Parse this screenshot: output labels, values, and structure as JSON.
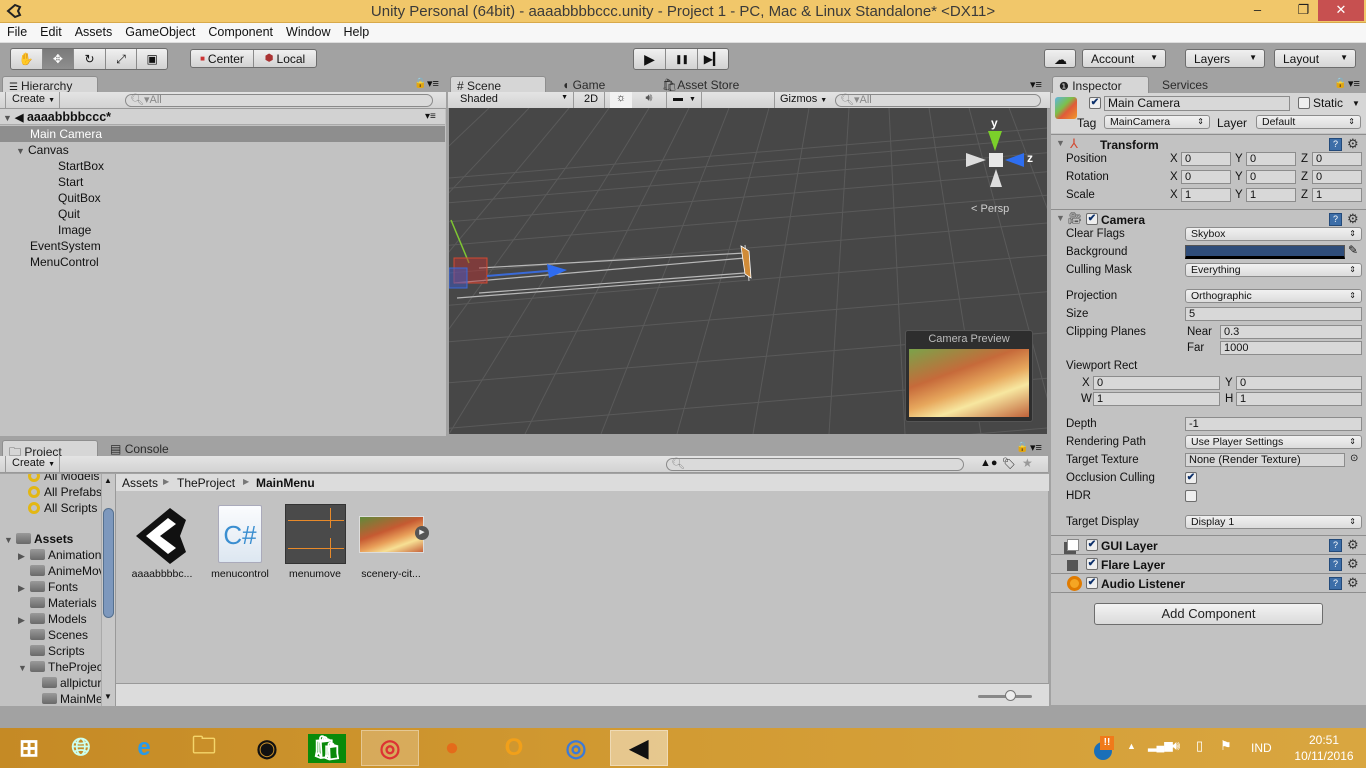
{
  "window": {
    "title": "Unity Personal (64bit) - aaaabbbbccc.unity - Project 1 - PC, Mac & Linux Standalone* <DX11>",
    "minimize": "–",
    "restore": "❐",
    "close": "✕"
  },
  "menu": [
    "File",
    "Edit",
    "Assets",
    "GameObject",
    "Component",
    "Window",
    "Help"
  ],
  "toolbar": {
    "tools": [
      {
        "name": "hand-tool",
        "icon": "✋"
      },
      {
        "name": "move-tool",
        "icon": "✥",
        "active": true
      },
      {
        "name": "rotate-tool",
        "icon": "↻"
      },
      {
        "name": "scale-tool",
        "icon": "⤢"
      },
      {
        "name": "rect-tool",
        "icon": "▣"
      }
    ],
    "pivot_center": "Center",
    "pivot_local": "Local",
    "play": "▶",
    "pause": "❚❚",
    "step": "▶▎",
    "cloud": "☁",
    "account": "Account",
    "layers": "Layers",
    "layout": "Layout"
  },
  "hierarchy": {
    "tab": "Hierarchy",
    "create": "Create",
    "search_placeholder": "All",
    "scene_name": "aaaabbbbccc*",
    "items": [
      {
        "label": "Main Camera",
        "depth": 1,
        "selected": true
      },
      {
        "label": "Canvas",
        "depth": 1,
        "expanded": true
      },
      {
        "label": "StartBox",
        "depth": 2
      },
      {
        "label": "Start",
        "depth": 2
      },
      {
        "label": "QuitBox",
        "depth": 2
      },
      {
        "label": "Quit",
        "depth": 2
      },
      {
        "label": "Image",
        "depth": 2
      },
      {
        "label": "EventSystem",
        "depth": 1
      },
      {
        "label": "MenuControl",
        "depth": 1
      }
    ]
  },
  "scene": {
    "tabs": [
      "Scene",
      "Game",
      "Asset Store"
    ],
    "shading": "Shaded",
    "mode_2d": "2D",
    "gizmos": "Gizmos",
    "search_placeholder": "All",
    "gizmo_y": "y",
    "gizmo_z": "z",
    "persp": "Persp",
    "camera_preview": "Camera Preview"
  },
  "inspector": {
    "tabs": [
      "Inspector",
      "Services"
    ],
    "object_name": "Main Camera",
    "static_label": "Static",
    "tag_label": "Tag",
    "tag": "MainCamera",
    "layer_label": "Layer",
    "layer": "Default",
    "transform": {
      "title": "Transform",
      "rows": [
        {
          "label": "Position",
          "x": "0",
          "y": "0",
          "z": "0"
        },
        {
          "label": "Rotation",
          "x": "0",
          "y": "0",
          "z": "0"
        },
        {
          "label": "Scale",
          "x": "1",
          "y": "1",
          "z": "1"
        }
      ]
    },
    "camera": {
      "title": "Camera",
      "clear_flags_label": "Clear Flags",
      "clear_flags": "Skybox",
      "background_label": "Background",
      "background_color": "#2f4d7a",
      "culling_mask_label": "Culling Mask",
      "culling_mask": "Everything",
      "projection_label": "Projection",
      "projection": "Orthographic",
      "size_label": "Size",
      "size": "5",
      "clipping_label": "Clipping Planes",
      "near_label": "Near",
      "near": "0.3",
      "far_label": "Far",
      "far": "1000",
      "viewport_label": "Viewport Rect",
      "vx_label": "X",
      "vx": "0",
      "vy_label": "Y",
      "vy": "0",
      "vw_label": "W",
      "vw": "1",
      "vh_label": "H",
      "vh": "1",
      "depth_label": "Depth",
      "depth": "-1",
      "rendering_path_label": "Rendering Path",
      "rendering_path": "Use Player Settings",
      "target_texture_label": "Target Texture",
      "target_texture": "None (Render Texture)",
      "occlusion_label": "Occlusion Culling",
      "occlusion": true,
      "hdr_label": "HDR",
      "hdr": false,
      "target_display_label": "Target Display",
      "target_display": "Display 1"
    },
    "components": [
      "GUI Layer",
      "Flare Layer",
      "Audio Listener"
    ],
    "add_component": "Add Component"
  },
  "project": {
    "tabs": [
      "Project",
      "Console"
    ],
    "create": "Create",
    "favorites": [
      "All Models",
      "All Prefabs",
      "All Scripts"
    ],
    "assets_root": "Assets",
    "folders": [
      {
        "label": "Animation",
        "depth": 1,
        "arrow": true
      },
      {
        "label": "AnimeMove",
        "depth": 1
      },
      {
        "label": "Fonts",
        "depth": 1,
        "arrow": true
      },
      {
        "label": "Materials",
        "depth": 1
      },
      {
        "label": "Models",
        "depth": 1,
        "arrow": true
      },
      {
        "label": "Scenes",
        "depth": 1
      },
      {
        "label": "Scripts",
        "depth": 1
      },
      {
        "label": "TheProject",
        "depth": 1,
        "expanded": true
      },
      {
        "label": "allpictures",
        "depth": 2
      },
      {
        "label": "MainMenu",
        "depth": 2
      }
    ],
    "breadcrumb": [
      "Assets",
      "TheProject",
      "MainMenu"
    ],
    "assets": [
      {
        "label": "aaaabbbbc...",
        "kind": "scene"
      },
      {
        "label": "menucontrol",
        "kind": "script"
      },
      {
        "label": "menumove",
        "kind": "animation"
      },
      {
        "label": "scenery-cit...",
        "kind": "texture"
      }
    ],
    "zoom_level": 0.6
  },
  "taskbar": {
    "apps": [
      "Start",
      "Globe",
      "Internet Explorer",
      "File Explorer",
      "Camera",
      "Store",
      "Chrome",
      "Firefox",
      "Outlook",
      "Chromium",
      "Unity"
    ],
    "language": "IND",
    "time": "20:51",
    "date": "10/11/2016"
  }
}
